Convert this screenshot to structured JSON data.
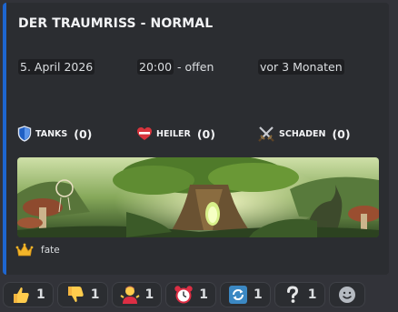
{
  "embed": {
    "title": "DER TRAUMRISS - NORMAL",
    "date": "5. April 2026",
    "time": "20:00",
    "time_suffix": " - offen",
    "relative": "vor 3 Monaten",
    "accent_color": "#1e66d0",
    "roles": [
      {
        "icon": "shield-icon",
        "label": "TANKS",
        "count": "(0)"
      },
      {
        "icon": "heart-icon",
        "label": "HEILER",
        "count": "(0)"
      },
      {
        "icon": "crossed-swords-icon",
        "label": "SCHADEN",
        "count": "(0)"
      }
    ],
    "banner_image": "fantasy-forest-tree-house",
    "footer": {
      "icon": "crown-icon",
      "name": "fate"
    }
  },
  "reactions": [
    {
      "icon": "thumbs-up-icon",
      "count": "1"
    },
    {
      "icon": "thumbs-down-icon",
      "count": "1"
    },
    {
      "icon": "person-shrug-icon",
      "count": "1"
    },
    {
      "icon": "alarm-clock-icon",
      "count": "1"
    },
    {
      "icon": "repeat-icon",
      "count": "1"
    },
    {
      "icon": "question-icon",
      "count": "1"
    },
    {
      "icon": "add-reaction-icon",
      "count": ""
    }
  ]
}
